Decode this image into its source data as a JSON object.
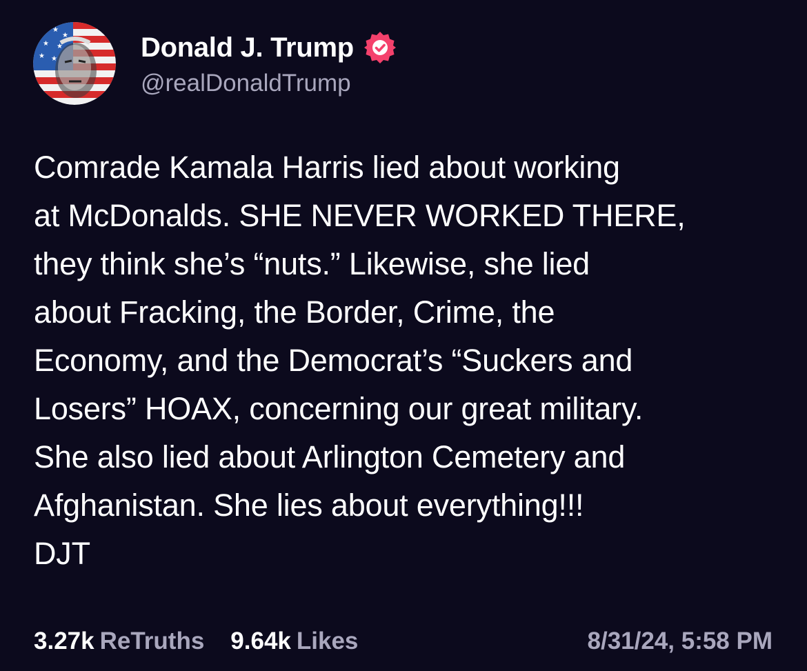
{
  "author": {
    "display_name": "Donald J. Trump",
    "handle": "@realDonaldTrump",
    "avatar_icon": "avatar-flag-portrait",
    "verified_icon": "verified-badge-icon",
    "verified_color": "#f4416c"
  },
  "post": {
    "text": "Comrade Kamala Harris lied about working\nat McDonalds. SHE NEVER WORKED THERE,\nthey think she’s “nuts.” Likewise, she lied\nabout Fracking, the Border, Crime, the\nEconomy, and the Democrat’s “Suckers and\nLosers” HOAX, concerning our great military.\nShe also lied about Arlington Cemetery and\nAfghanistan. She lies about everything!!!\nDJT"
  },
  "stats": {
    "retruths_count": "3.27k",
    "retruths_label": "ReTruths",
    "likes_count": "9.64k",
    "likes_label": "Likes",
    "timestamp": "8/31/24, 5:58 PM"
  },
  "theme": {
    "background": "#0c0a1d",
    "text": "#ffffff",
    "muted": "#a9a7bd"
  }
}
